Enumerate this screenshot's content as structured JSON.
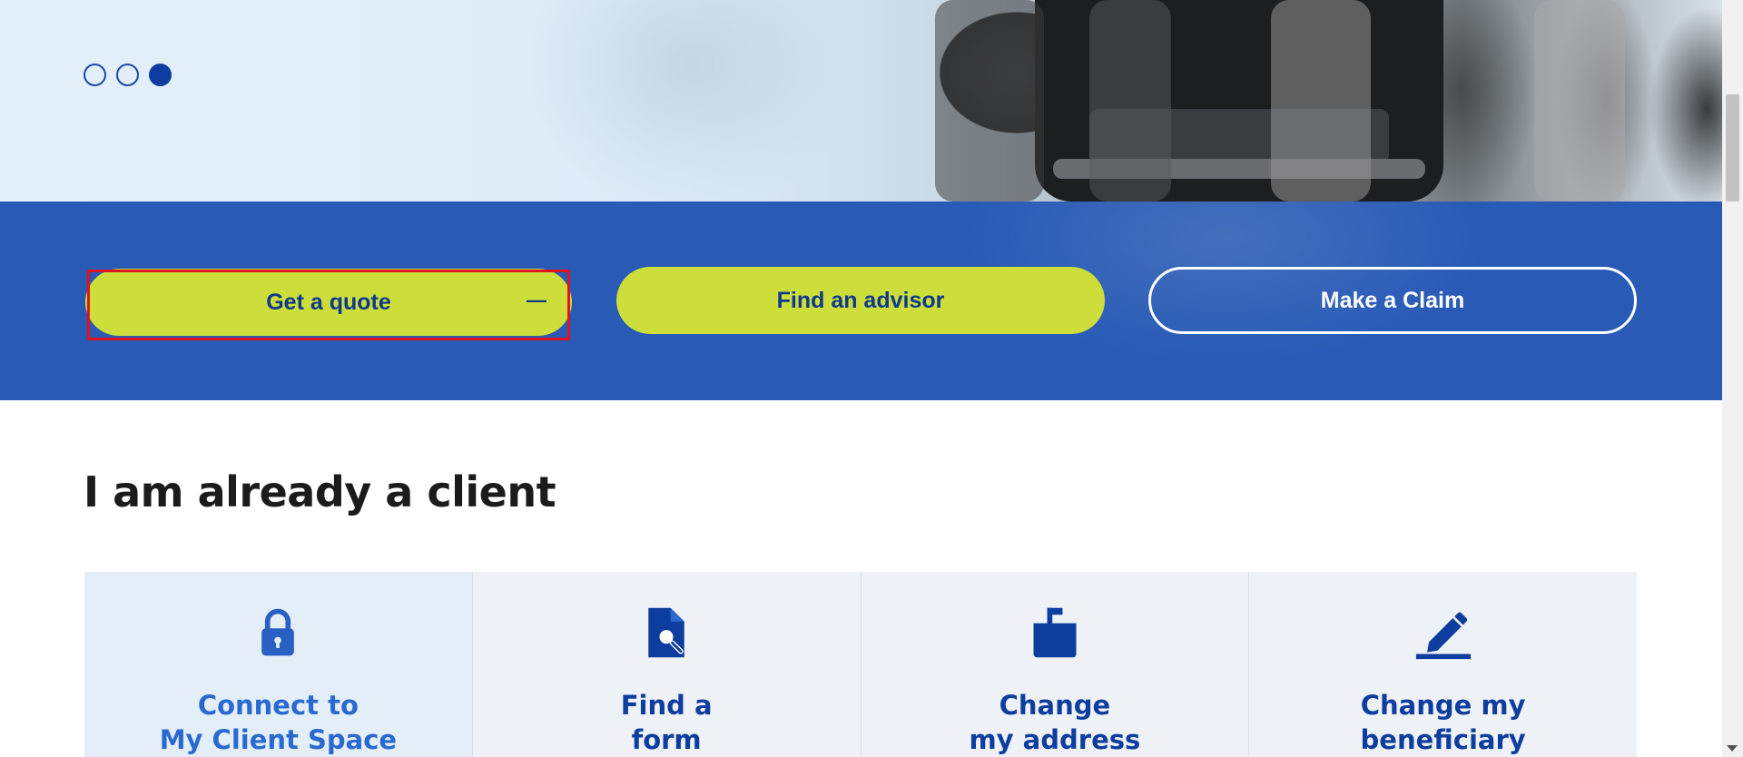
{
  "carousel": {
    "dots": [
      {
        "label": "Slide 1",
        "active": false
      },
      {
        "label": "Slide 2",
        "active": false
      },
      {
        "label": "Slide 3",
        "active": true
      }
    ]
  },
  "cta": {
    "quote_label": "Get a quote",
    "advisor_label": "Find an advisor",
    "claim_label": "Make a Claim",
    "accent": "#cddd3a",
    "band_color": "#285ab6"
  },
  "client_section": {
    "title": "I am already a client",
    "tiles": [
      {
        "label": "Connect to\nMy Client Space",
        "icon": "lock-icon"
      },
      {
        "label": "Find a\nform",
        "icon": "document-search-icon"
      },
      {
        "label": "Change\nmy address",
        "icon": "mailbox-icon"
      },
      {
        "label": "Change my\nbeneficiary",
        "icon": "pencil-icon"
      }
    ]
  }
}
